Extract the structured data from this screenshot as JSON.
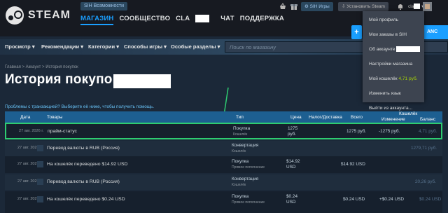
{
  "header": {
    "logo_text": "STEAM",
    "sih_label": "SIH Возможности",
    "nav": {
      "store": "МАГАЗИН",
      "community": "СООБЩЕСТВО",
      "user": "CLA",
      "chat": "ЧАТ",
      "support": "ПОДДЕРЖКА"
    },
    "sih_games": "SIH Игры",
    "install": "Установить Steam",
    "account_name": "cla",
    "install_right": "ANC"
  },
  "account_menu": {
    "items": [
      "Мой профиль",
      "Мои заказы в SIH",
      "Об аккаунте",
      "Настройки магазина",
      "Мой кошелёк",
      "Изменить язык",
      "Выйти из аккаунта..."
    ],
    "wallet_amount": "4,71 руб."
  },
  "store_nav": {
    "items": [
      "Просмотр",
      "Рекомендации",
      "Категории",
      "Способы игры",
      "Особые разделы"
    ],
    "search_placeholder": "Поиск по магазину"
  },
  "page": {
    "breadcrumb": "Главная > Аккаунт > История покупок",
    "title": "История покупок",
    "problems_link": "Проблемы с транзакцией? Выберите её ниже, чтобы получить помощь."
  },
  "table": {
    "headers": {
      "date": "Дата",
      "items": "Товары",
      "type": "Тип",
      "price": "Цена",
      "tax": "Налог/Доставка",
      "total": "Всего",
      "wallet": "Кошелёк",
      "change": "Изменение",
      "balance": "Баланс"
    },
    "rows": [
      {
        "date": "27 авг. 2026 г.",
        "item": "прайм-статус",
        "type": "Покупка",
        "type_sub": "Кошелёк",
        "price": "1275 руб.",
        "tax": "",
        "total": "1275 руб.",
        "change": "-1275 руб.",
        "balance": "4,71 руб."
      },
      {
        "date": "27 авг. 2026 г.",
        "item": "Перевод валюты в RUB (Россия)",
        "type": "Конвертация",
        "type_sub": "Кошелёк",
        "price": "",
        "tax": "",
        "total": "",
        "change": "",
        "balance": "1279,71 руб."
      },
      {
        "date": "27 авг. 2026 г.",
        "item": "На кошелёк переведено $14.92 USD",
        "type": "Покупка",
        "type_sub": "Прямое пополнение",
        "price": "$14.92 USD",
        "tax": "",
        "total": "$14.92 USD",
        "change": "",
        "balance": ""
      },
      {
        "date": "27 авг. 2026 г.",
        "item": "Перевод валюты в RUB (Россия)",
        "type": "Конвертация",
        "type_sub": "Кошелёк",
        "price": "",
        "tax": "",
        "total": "",
        "change": "",
        "balance": "20,26 руб."
      },
      {
        "date": "27 авг. 2026 г.",
        "item": "На кошелёк переведено $0.24 USD",
        "type": "Покупка",
        "type_sub": "Прямое пополнение",
        "price": "$0.24 USD",
        "tax": "",
        "total": "$0.24 USD",
        "change": "+$0.24 USD",
        "balance": "$0.24 USD"
      }
    ]
  },
  "colors": {
    "bg": "#1b2838",
    "accent": "#1a9fff",
    "table_header": "#1d5f91",
    "highlight": "#2ecc71",
    "wallet": "#a4d007"
  }
}
